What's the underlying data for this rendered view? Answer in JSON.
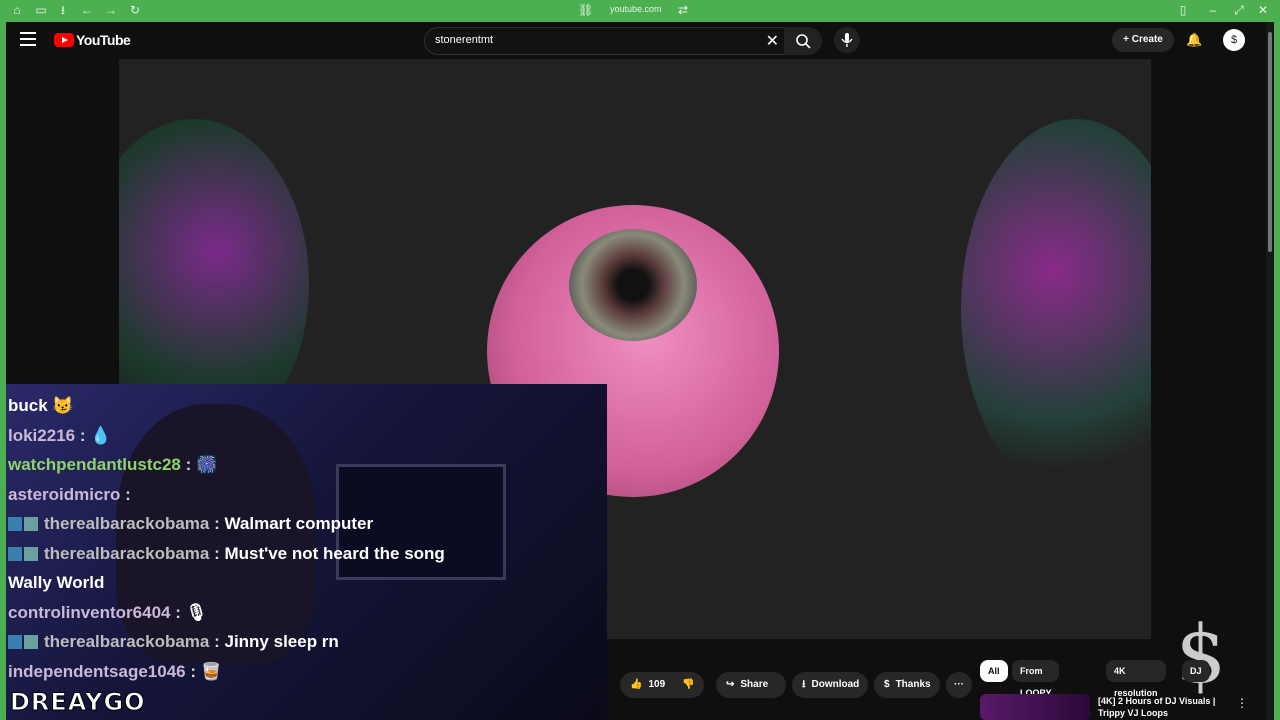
{
  "browser": {
    "url": "youtube.com"
  },
  "masthead": {
    "logo_text": "YouTube",
    "search_query": "stonerentmt",
    "create_label": "Create",
    "avatar_glyph": "$"
  },
  "overlay": {
    "chat": [
      {
        "user": "",
        "sep": "",
        "msg": "buck 😼",
        "badges": false,
        "color": "plain"
      },
      {
        "user": "loki2216",
        "sep": " : ",
        "msg": "💧",
        "badges": false,
        "color": "cyan"
      },
      {
        "user": "watchpendantlustc28",
        "sep": " : ",
        "msg": "🎆",
        "badges": false,
        "color": "green"
      },
      {
        "user": "asteroidmicro",
        "sep": " : ",
        "msg": "",
        "badges": false,
        "color": "cyan"
      },
      {
        "user": "therealbarackobama",
        "sep": " : ",
        "msg": "Walmart computer",
        "badges": true,
        "color": "grey"
      },
      {
        "user": "therealbarackobama",
        "sep": " : ",
        "msg": "Must've not heard the song",
        "badges": true,
        "color": "grey"
      },
      {
        "user": "",
        "sep": "",
        "msg": "Wally World",
        "badges": false,
        "color": "plain"
      },
      {
        "user": "controlinventor6404",
        "sep": " : ",
        "msg": "🎙",
        "badges": false,
        "color": "cyan"
      },
      {
        "user": "therealbarackobama",
        "sep": " : ",
        "msg": "Jinny sleep rn",
        "badges": true,
        "color": "grey"
      },
      {
        "user": "independentsage1046",
        "sep": " : ",
        "msg": "🥃",
        "badges": false,
        "color": "cyan"
      }
    ],
    "streamer_name": "DREAYGO"
  },
  "actions": {
    "like_count": "109",
    "share_label": "Share",
    "download_label": "Download",
    "thanks_label": "Thanks",
    "more_label": "···"
  },
  "chips": [
    "All",
    "From LOOPY LAD",
    "4K resolution",
    "DJ"
  ],
  "recommendation": {
    "title": "[4K] 2 Hours of DJ Visuals | Trippy VJ Loops"
  },
  "colors": {
    "browser_frame": "#4caf50",
    "yt_red": "#ff0000",
    "background": "#0f0f0f"
  }
}
